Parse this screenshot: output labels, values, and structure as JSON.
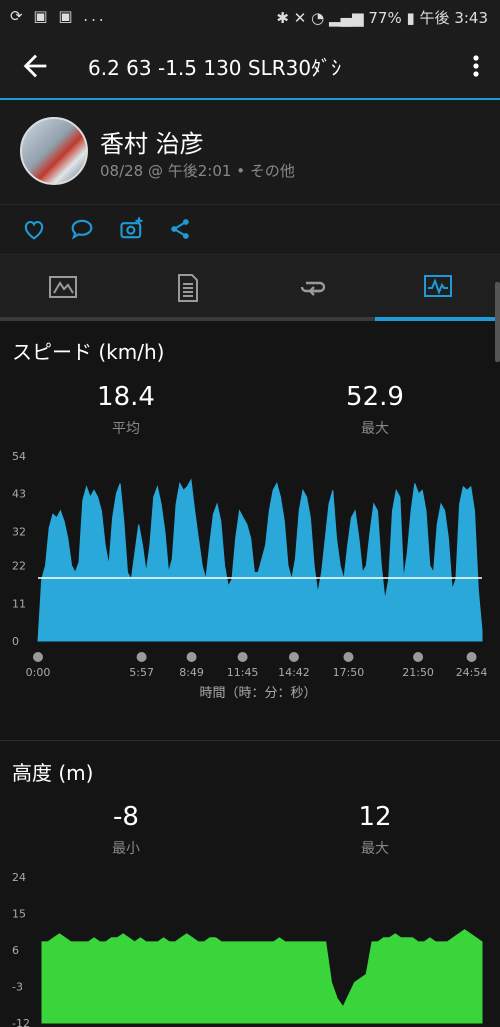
{
  "status_bar": {
    "left_icons": [
      "sync-icon",
      "image-icon",
      "tiktok-icon"
    ],
    "left_more": "...",
    "battery": "77%",
    "time": "午後 3:43"
  },
  "app_bar": {
    "title": "6.2  63   -1.5  130  SLR30ﾀﾞｼ"
  },
  "profile": {
    "name": "香村 治彦",
    "subtitle": "08/28 @ 午後2:01 • その他"
  },
  "actions": [
    "like-icon",
    "comment-icon",
    "add-photo-icon",
    "share-icon"
  ],
  "tabs": [
    {
      "name": "tab-map",
      "icon": "map-icon"
    },
    {
      "name": "tab-details",
      "icon": "document-icon"
    },
    {
      "name": "tab-laps",
      "icon": "loop-icon"
    },
    {
      "name": "tab-charts",
      "icon": "chart-icon",
      "selected": true
    }
  ],
  "speed": {
    "title": "スピード (km/h)",
    "avg_value": "18.4",
    "avg_label": "平均",
    "max_value": "52.9",
    "max_label": "最大"
  },
  "altitude": {
    "title": "高度 (m)",
    "min_value": "-8",
    "min_label": "最小",
    "max_value": "12",
    "max_label": "最大"
  },
  "chart_data": [
    {
      "type": "area",
      "xlabel": "時間（時：分：秒）",
      "ylabel": "",
      "yticks": [
        "0",
        "11",
        "22",
        "32",
        "43",
        "54"
      ],
      "ylim": [
        0,
        54
      ],
      "xticks": [
        "0:00",
        "5:57",
        "8:49",
        "11:45",
        "14:42",
        "17:50",
        "21:50",
        "24:54"
      ],
      "xtick_pos": [
        0,
        5.95,
        8.82,
        11.75,
        14.7,
        17.83,
        21.83,
        24.9
      ],
      "xlim": [
        0,
        25.5
      ],
      "average_line": 18.4,
      "color": "#29a8d9",
      "series": [
        {
          "values": [
            0,
            18,
            22,
            33,
            37,
            36,
            38,
            35,
            30,
            22,
            20,
            23,
            41,
            45,
            42,
            44,
            42,
            38,
            28,
            22,
            36,
            43,
            46,
            35,
            20,
            18,
            26,
            34,
            28,
            20,
            28,
            42,
            45,
            40,
            32,
            20,
            24,
            40,
            46,
            44,
            45,
            47,
            38,
            30,
            22,
            18,
            28,
            37,
            40,
            35,
            22,
            16,
            18,
            30,
            38,
            36,
            34,
            30,
            20,
            20,
            24,
            28,
            38,
            44,
            46,
            42,
            35,
            22,
            18,
            24,
            38,
            44,
            42,
            36,
            22,
            14,
            20,
            30,
            40,
            44,
            30,
            22,
            18,
            28,
            36,
            38,
            30,
            20,
            22,
            32,
            40,
            38,
            22,
            12,
            18,
            38,
            44,
            42,
            18,
            26,
            38,
            46,
            43,
            44,
            38,
            22,
            20,
            34,
            40,
            38,
            30,
            15,
            18,
            40,
            45,
            44,
            45,
            38,
            15,
            3
          ]
        }
      ]
    },
    {
      "type": "area",
      "yticks": [
        "-12",
        "-3",
        "6",
        "15",
        "24"
      ],
      "ylim": [
        -12,
        24
      ],
      "xlim": [
        0,
        25.5
      ],
      "color": "#3ad53a",
      "series": [
        {
          "values": [
            8,
            8,
            9,
            10,
            9,
            8,
            8,
            8,
            8,
            9,
            8,
            8,
            9,
            9,
            10,
            9,
            8,
            9,
            8,
            8,
            8,
            9,
            8,
            8,
            9,
            10,
            9,
            8,
            8,
            9,
            9,
            8,
            8,
            8,
            8,
            8,
            8,
            8,
            8,
            8,
            8,
            9,
            8,
            8,
            8,
            8,
            8,
            8,
            8,
            8,
            -2,
            -6,
            -8,
            -5,
            -2,
            -1,
            0,
            8,
            8,
            9,
            9,
            10,
            9,
            9,
            9,
            8,
            8,
            9,
            8,
            8,
            8,
            9,
            10,
            11,
            10,
            9,
            8
          ]
        }
      ]
    }
  ]
}
